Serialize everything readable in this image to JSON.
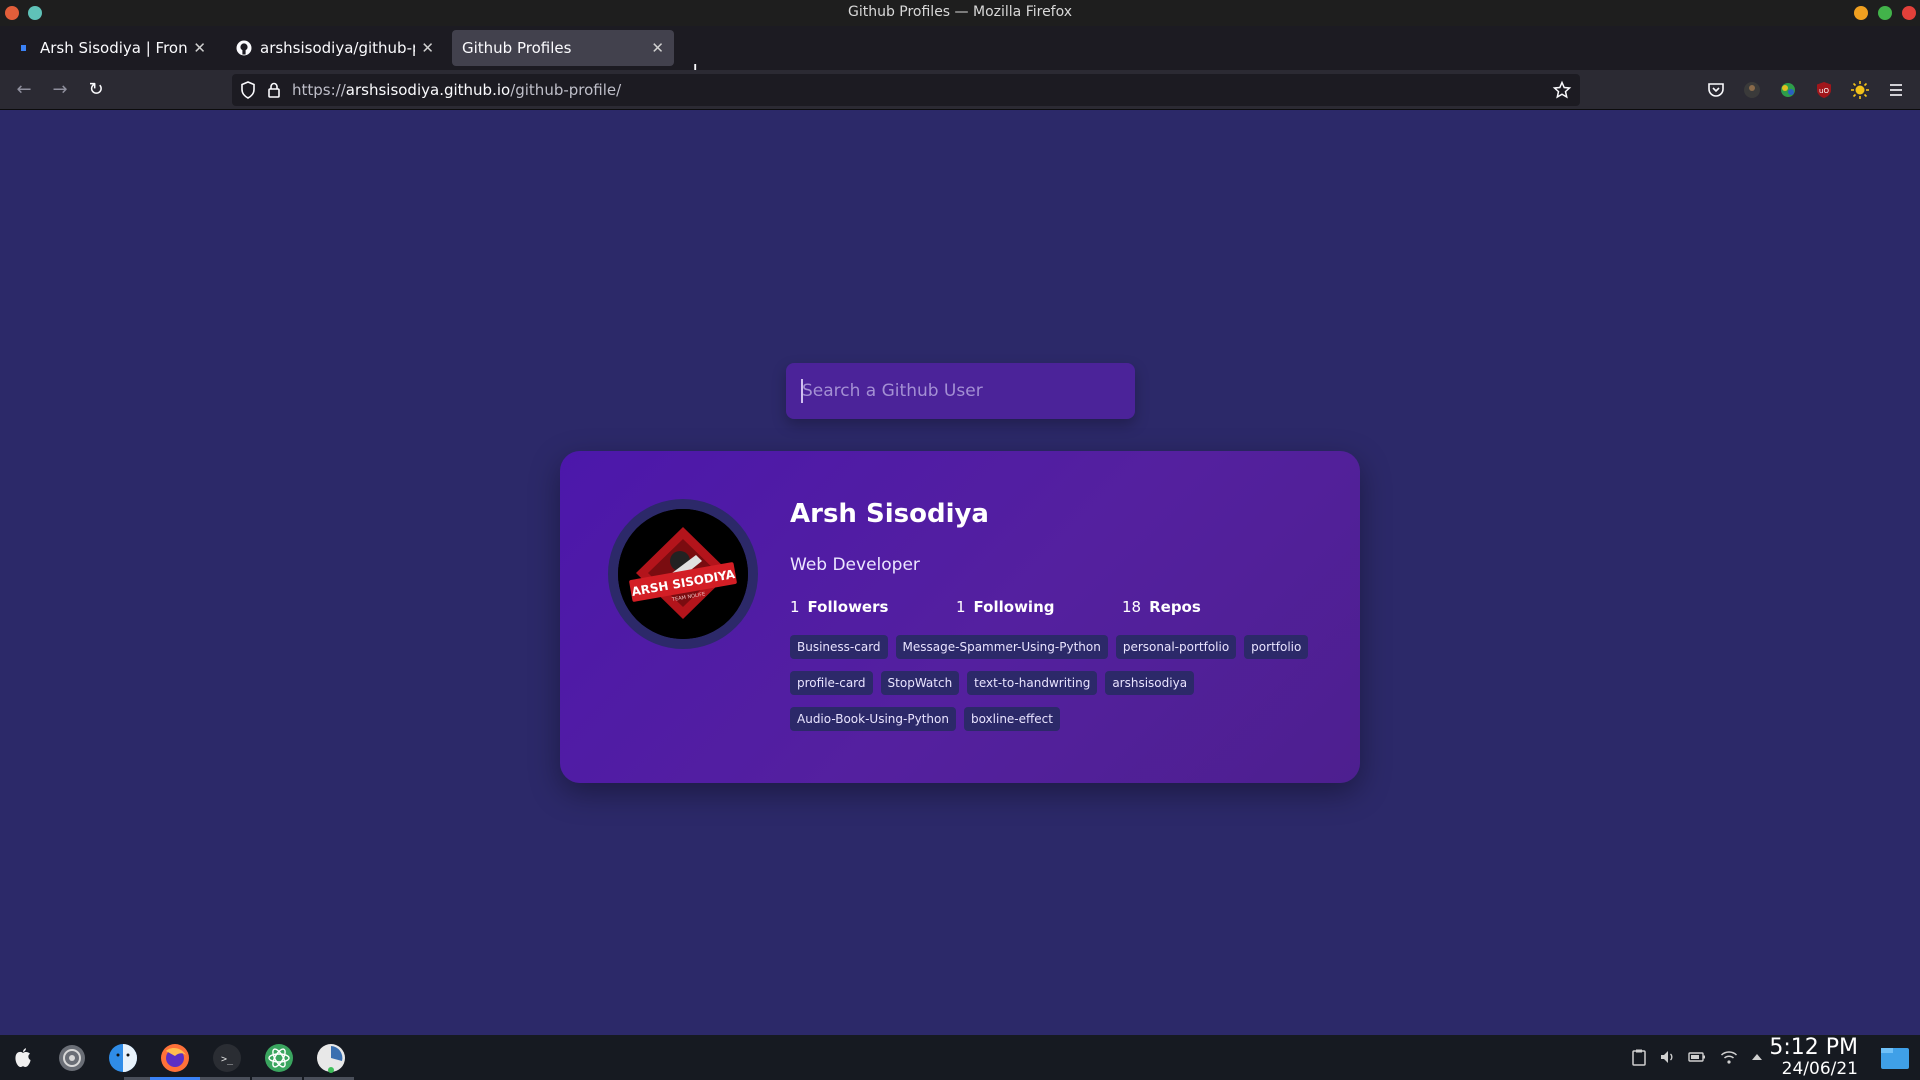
{
  "window": {
    "title": "Github Profiles — Mozilla Firefox"
  },
  "tabs": [
    {
      "label": "Arsh Sisodiya | Front End",
      "icon": "site-favicon",
      "active": false
    },
    {
      "label": "arshsisodiya/github-profil",
      "icon": "github-icon",
      "active": false
    },
    {
      "label": "Github Profiles",
      "icon": "none",
      "active": true
    }
  ],
  "new_tab_label": "+",
  "urlbar": {
    "prefix": "https://",
    "host": "arshsisodiya.github.io",
    "path": "/github-profile/"
  },
  "page": {
    "search_placeholder": "Search a Github User",
    "profile": {
      "name": "Arsh Sisodiya",
      "bio": "Web Developer",
      "followers_count": "1",
      "followers_label": "Followers",
      "following_count": "1",
      "following_label": "Following",
      "repos_count": "18",
      "repos_label": "Repos",
      "avatar_text": "ARSH SISODIYA",
      "avatar_subtext": "TEAM NOLIFE",
      "repos": [
        "Business-card",
        "Message-Spammer-Using-Python",
        "personal-portfolio",
        "portfolio",
        "profile-card",
        "StopWatch",
        "text-to-handwriting",
        "arshsisodiya",
        "Audio-Book-Using-Python",
        "boxline-effect"
      ]
    }
  },
  "taskbar": {
    "time": "5:12 PM",
    "date": "24/06/21"
  },
  "colors": {
    "page_bg": "#2c2969",
    "card_bg": "#4c17ab",
    "search_bg": "#4b2399",
    "tag_bg": "#2c2969"
  }
}
